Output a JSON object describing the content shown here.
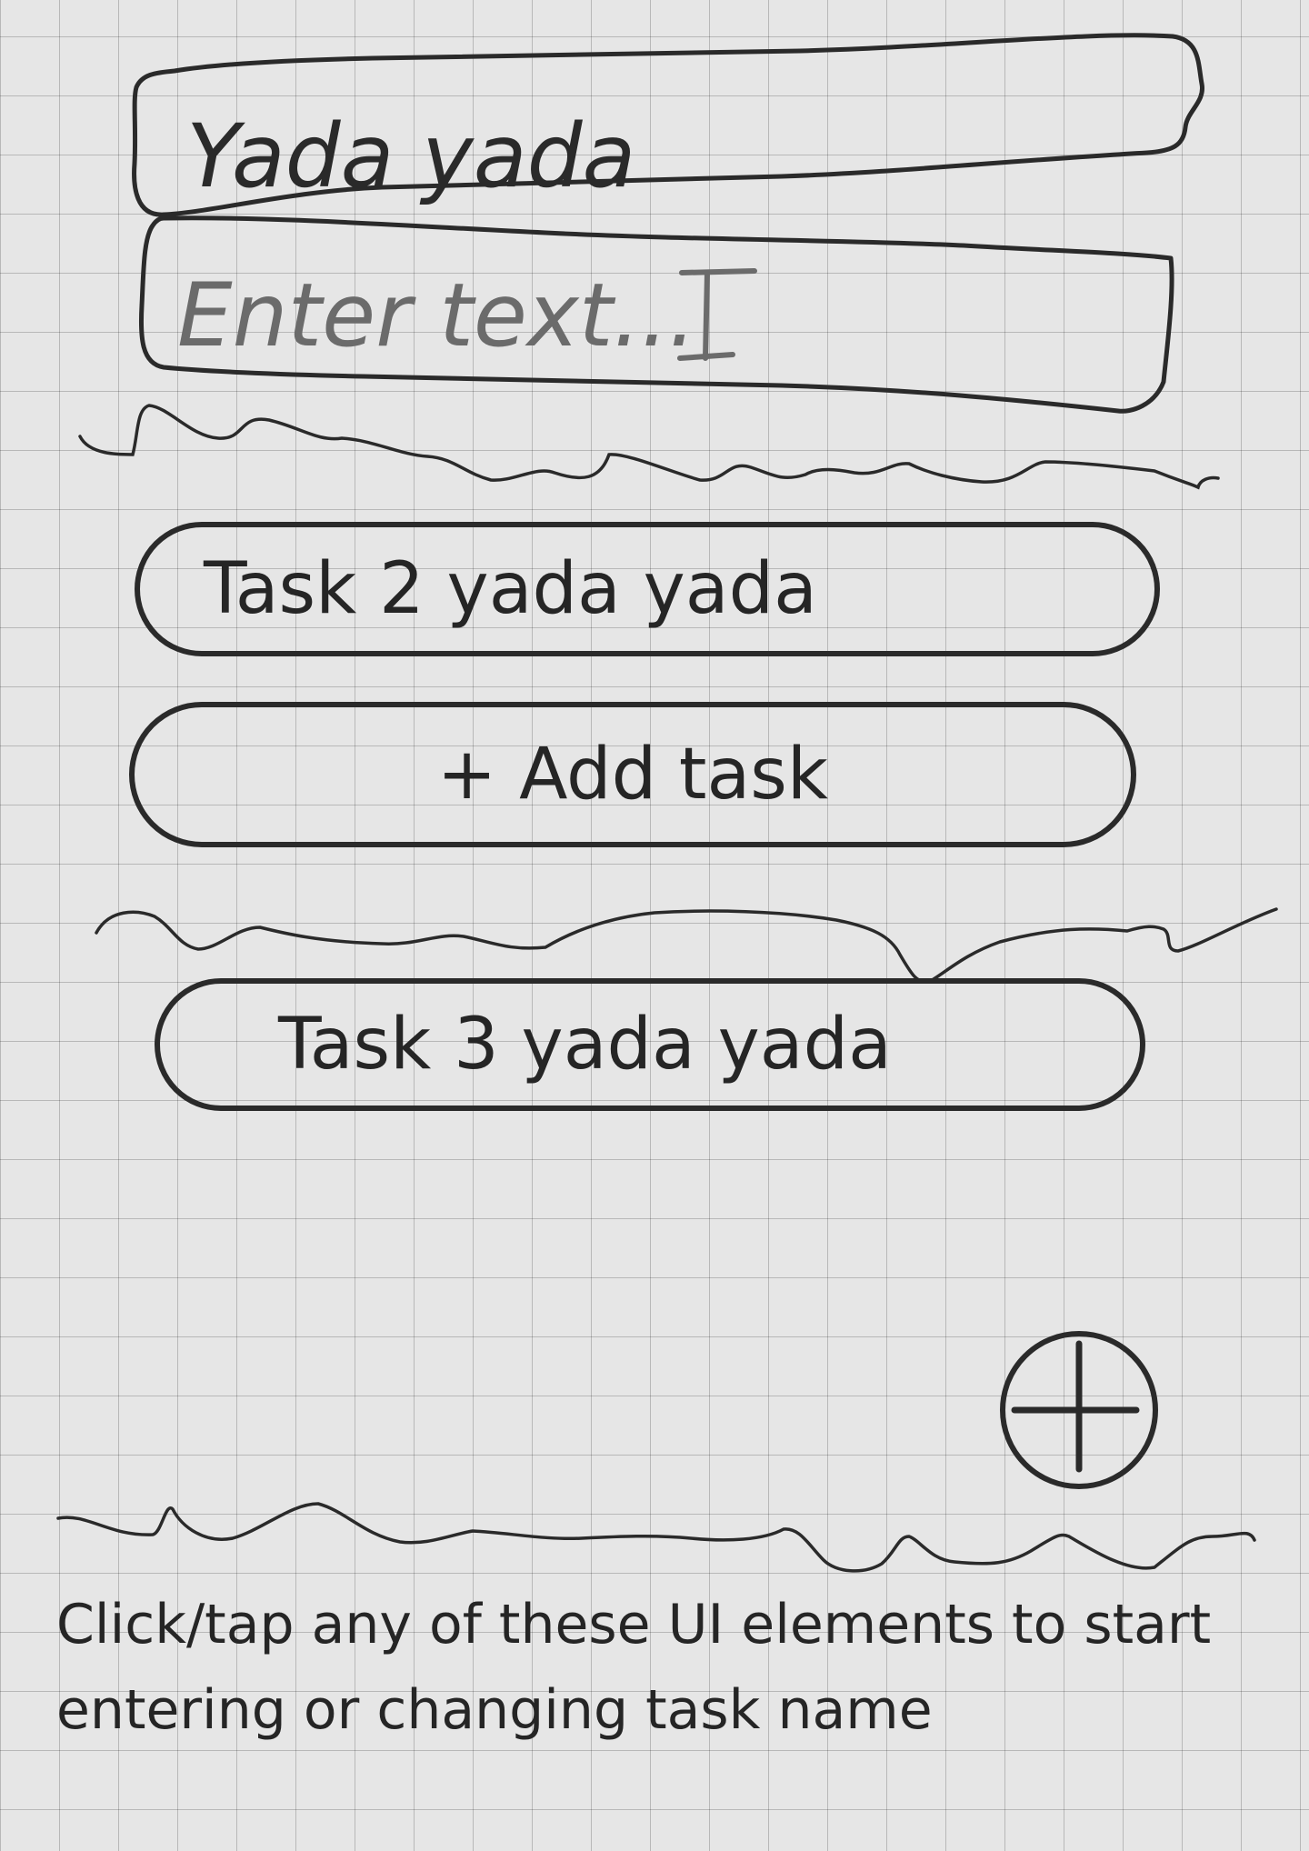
{
  "task_title_input": {
    "value": "Yada yada"
  },
  "task_text_input": {
    "placeholder": "Enter text..."
  },
  "tasks": [
    {
      "label": "Task 2 yada yada"
    },
    {
      "label": "Task 3 yada yada"
    }
  ],
  "add_task_button": {
    "label": "+ Add task"
  },
  "fab": {
    "icon": "plus-circle-icon"
  },
  "hint_text": "Click/tap any of these UI elements to start entering or changing task name",
  "colors": {
    "background": "#e6e6e6",
    "ink": "#2a2a2a",
    "placeholder_ink": "#6b6b6b",
    "grid": "#b5b5b5"
  }
}
